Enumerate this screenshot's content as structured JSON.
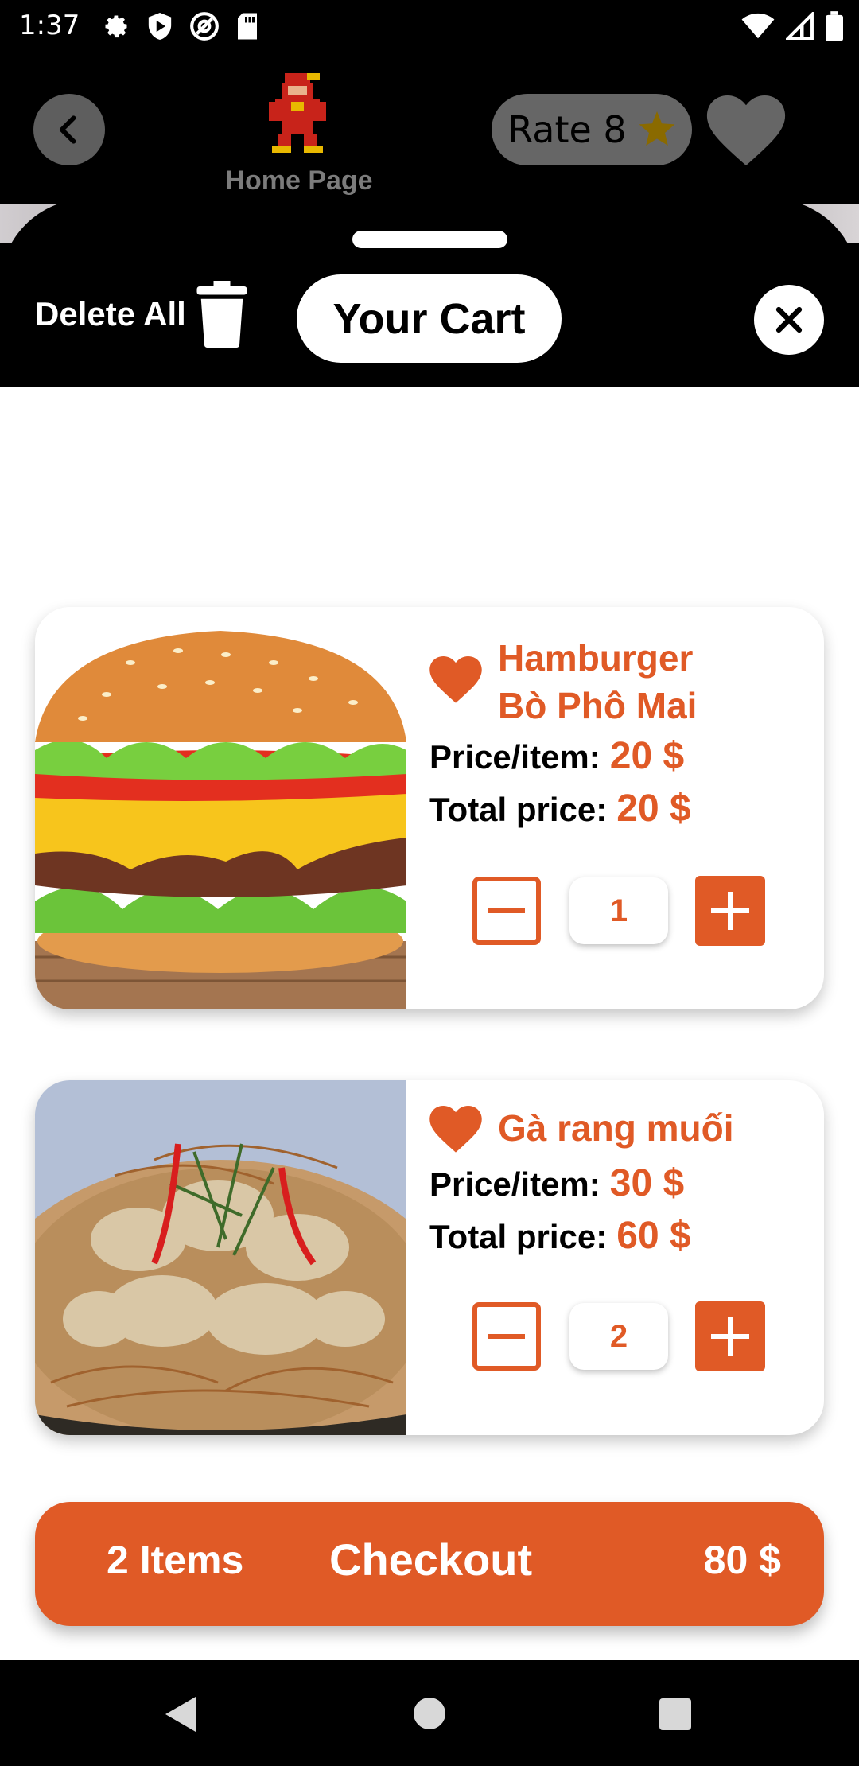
{
  "status_bar": {
    "time": "1:37",
    "left_icons": [
      "settings-icon",
      "shield-icon",
      "at-sign-icon",
      "sd-card-icon"
    ],
    "right_icons": [
      "wifi-icon",
      "signal-icon",
      "battery-icon"
    ]
  },
  "header": {
    "home_label": "Home Page",
    "rate_label": "Rate 8"
  },
  "cart": {
    "delete_all_label": "Delete All",
    "title": "Your Cart"
  },
  "items": [
    {
      "name": "Hamburger\nBò Phô Mai",
      "price_label": "Price/item:",
      "price_value": "20",
      "total_label": "Total price:",
      "total_value": "20",
      "currency": "$",
      "quantity": "1"
    },
    {
      "name": "Gà rang muối",
      "price_label": "Price/item:",
      "price_value": "30",
      "total_label": "Total price:",
      "total_value": "60",
      "currency": "$",
      "quantity": "2"
    }
  ],
  "checkout": {
    "items_label": "2 Items",
    "button_label": "Checkout",
    "total": "80 $"
  },
  "colors": {
    "accent": "#e05a26",
    "pill_gray": "#666666",
    "star_gold": "#8a6a00"
  }
}
